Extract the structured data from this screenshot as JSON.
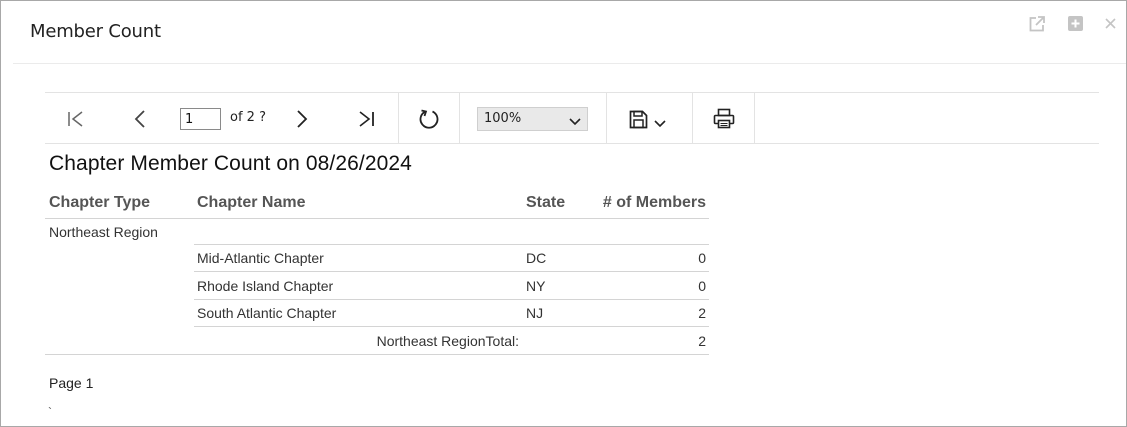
{
  "dialog": {
    "title": "Member Count"
  },
  "toolbar": {
    "page_value": "1",
    "page_of": "of 2 ?",
    "zoom": "100%"
  },
  "report": {
    "title": "Chapter Member Count on 08/26/2024",
    "columns": {
      "type": "Chapter Type",
      "name": "Chapter Name",
      "state": "State",
      "members": "# of Members"
    },
    "group": {
      "type": "Northeast Region",
      "rows": [
        {
          "name": "Mid-Atlantic Chapter",
          "state": "DC",
          "members": "0"
        },
        {
          "name": "Rhode Island Chapter",
          "state": "NY",
          "members": "0"
        },
        {
          "name": "South Atlantic Chapter",
          "state": "NJ",
          "members": "2"
        }
      ],
      "total_label": "Northeast RegionTotal:",
      "total_value": "2"
    },
    "footer": "Page 1",
    "trailing_mark": "`"
  }
}
